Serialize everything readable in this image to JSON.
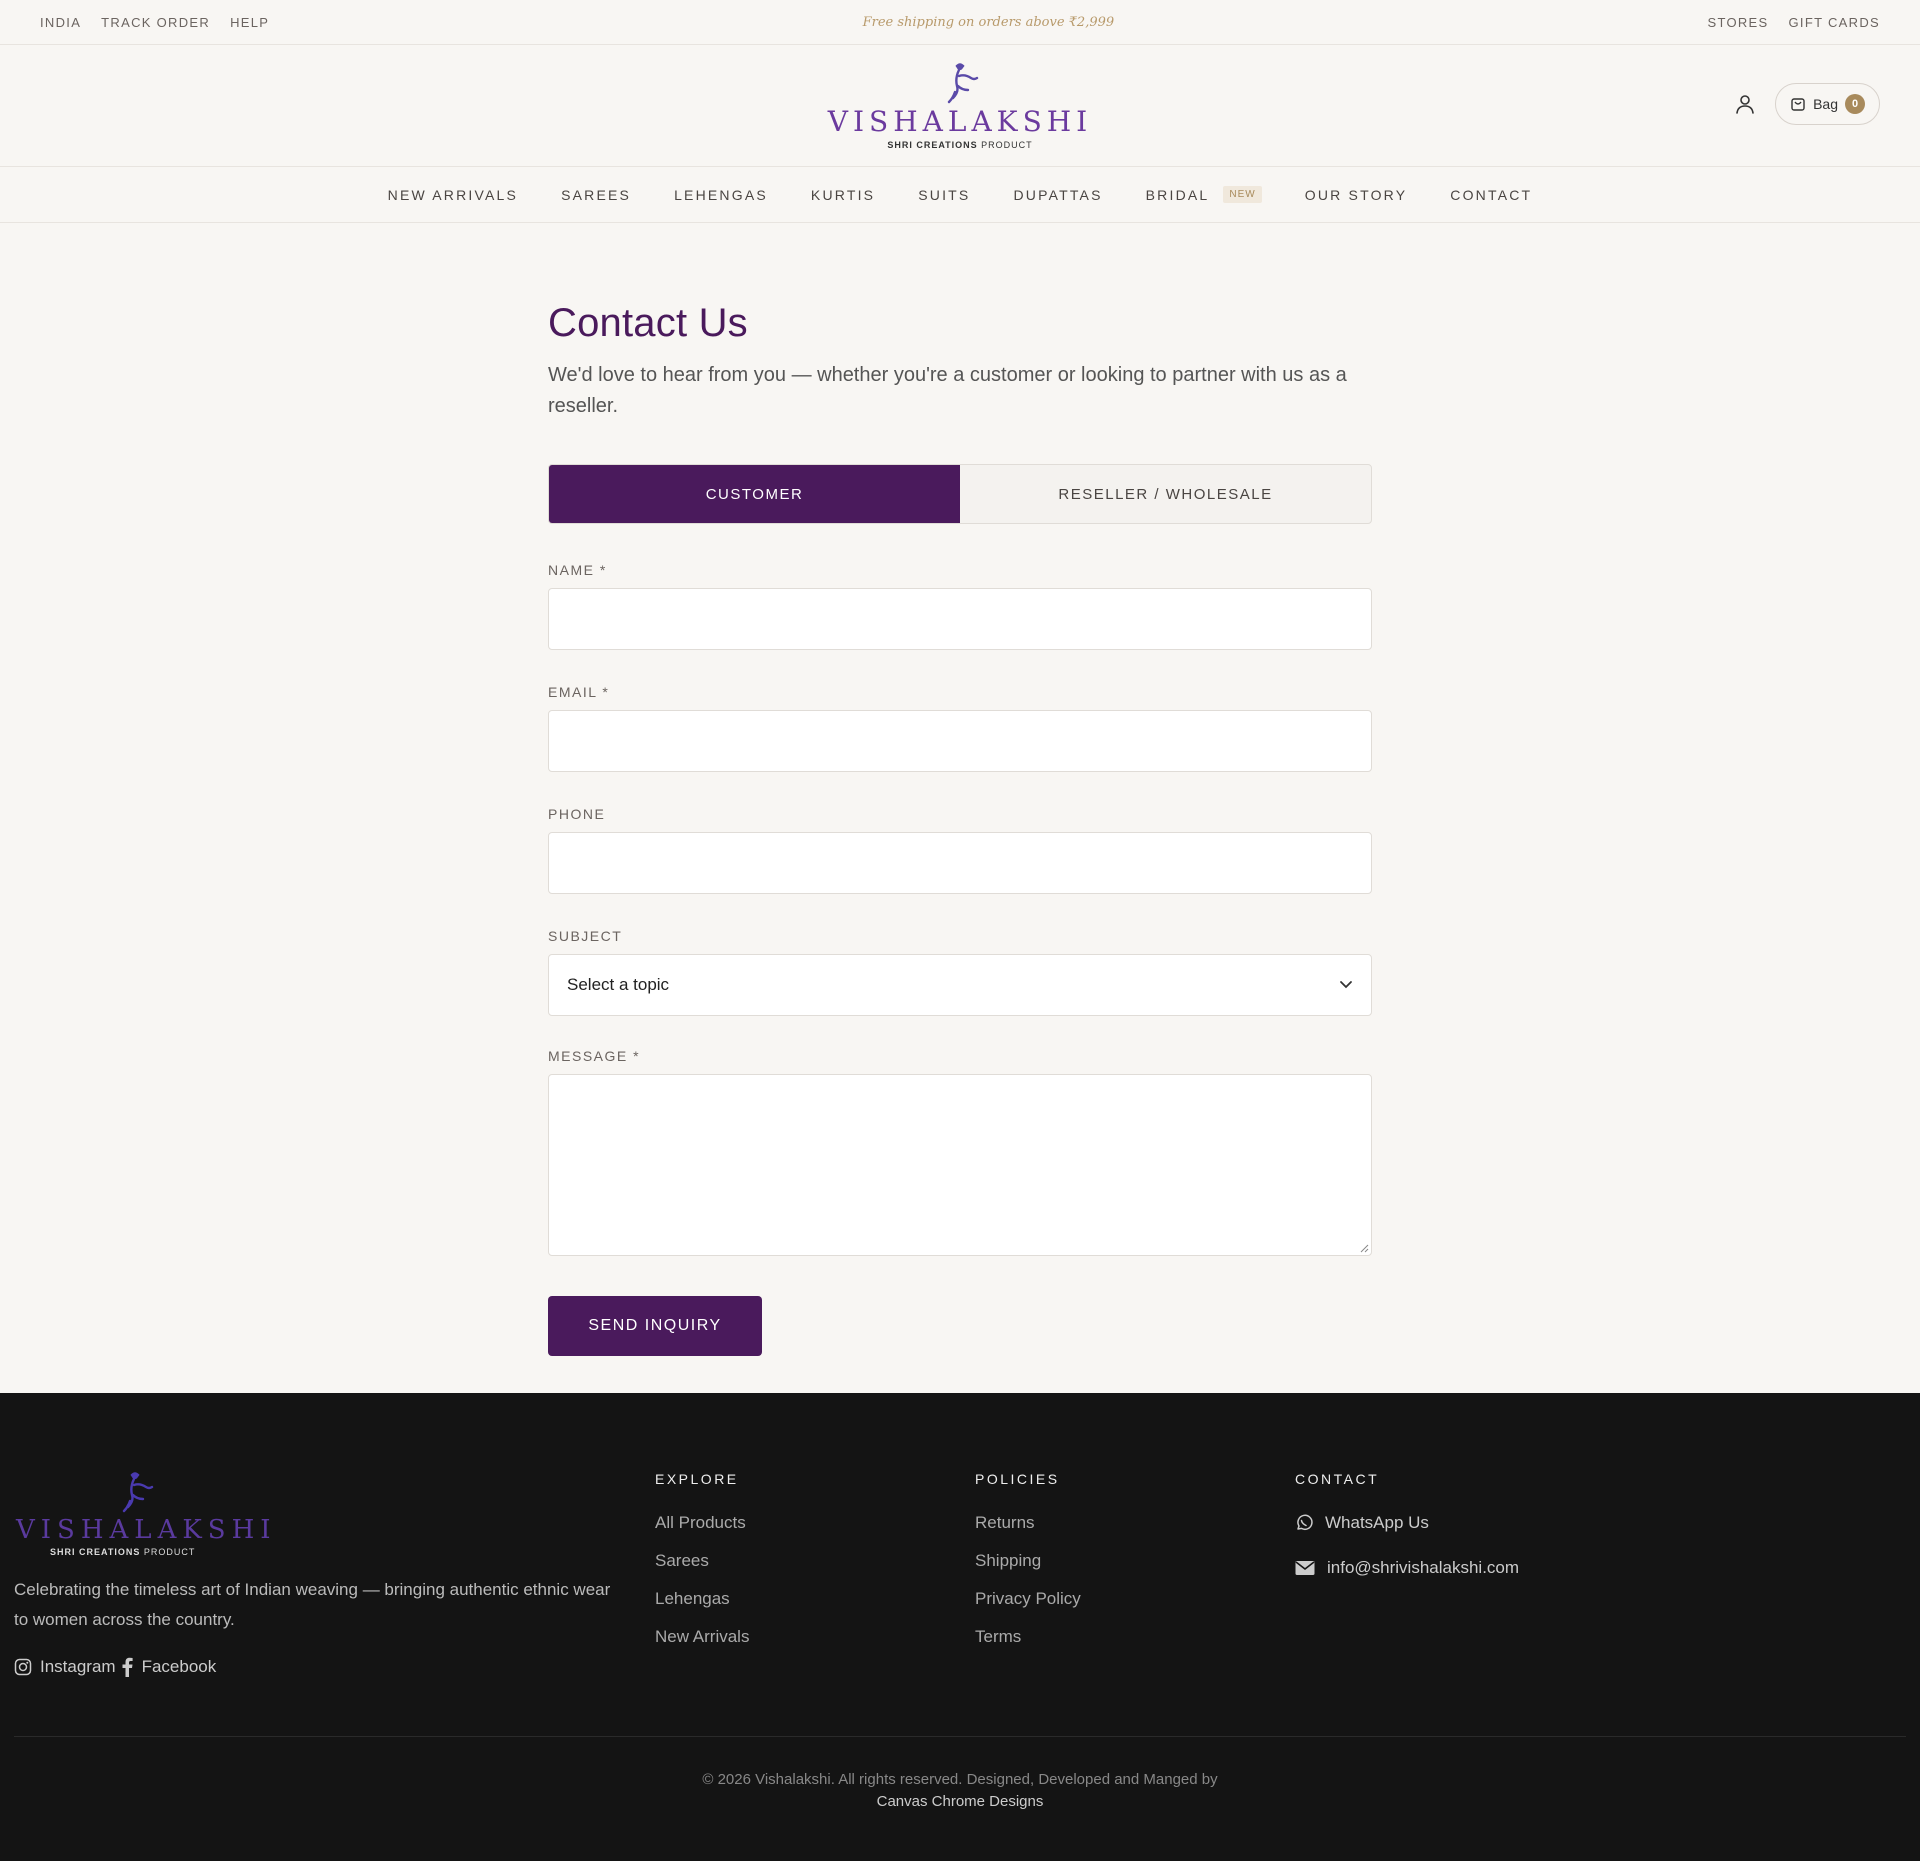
{
  "utility": {
    "left_links": [
      "INDIA",
      "TRACK ORDER",
      "HELP"
    ],
    "promo": "Free shipping on orders above ₹2,999",
    "right_links": [
      "STORES",
      "GIFT CARDS"
    ]
  },
  "brand": {
    "name": "VISHALAKSHI",
    "sub_bold": "SHRI CREATIONS",
    "sub_rest": "PRODUCT"
  },
  "header": {
    "bag_label": "Bag",
    "bag_count": "0"
  },
  "nav": {
    "items": [
      "NEW ARRIVALS",
      "SAREES",
      "LEHENGAS",
      "KURTIS",
      "SUITS",
      "DUPATTAS",
      "BRIDAL",
      "OUR STORY",
      "CONTACT"
    ],
    "bridal_badge": "NEW"
  },
  "contact": {
    "title": "Contact Us",
    "intro": "We'd love to hear from you — whether you're a customer or looking to partner with us as a reseller.",
    "tabs": [
      "CUSTOMER",
      "RESELLER / WHOLESALE"
    ],
    "active_tab": "CUSTOMER",
    "fields": {
      "name_label": "NAME *",
      "email_label": "EMAIL *",
      "phone_label": "PHONE",
      "subject_label": "SUBJECT",
      "subject_value": "Select a topic",
      "message_label": "MESSAGE *"
    },
    "submit_label": "SEND INQUIRY"
  },
  "footer": {
    "description": "Celebrating the timeless art of Indian weaving — bringing authentic ethnic wear to women across the country.",
    "social": [
      "Instagram",
      "Facebook"
    ],
    "explore": {
      "heading": "EXPLORE",
      "links": [
        "All Products",
        "Sarees",
        "Lehengas",
        "New Arrivals"
      ]
    },
    "policies": {
      "heading": "POLICIES",
      "links": [
        "Returns",
        "Shipping",
        "Privacy Policy",
        "Terms"
      ]
    },
    "contact": {
      "heading": "CONTACT",
      "whatsapp": "WhatsApp Us",
      "email": "info@shrivishalakshi.com"
    },
    "copyright": "© 2026 Vishalakshi. All rights reserved. Designed, Developed and Manged by",
    "credit": "Canvas Chrome Designs"
  },
  "colors": {
    "brand_purple": "#4a1a5c",
    "gold": "#a88a5c",
    "background": "#f8f6f3",
    "footer_bg": "#141414"
  }
}
